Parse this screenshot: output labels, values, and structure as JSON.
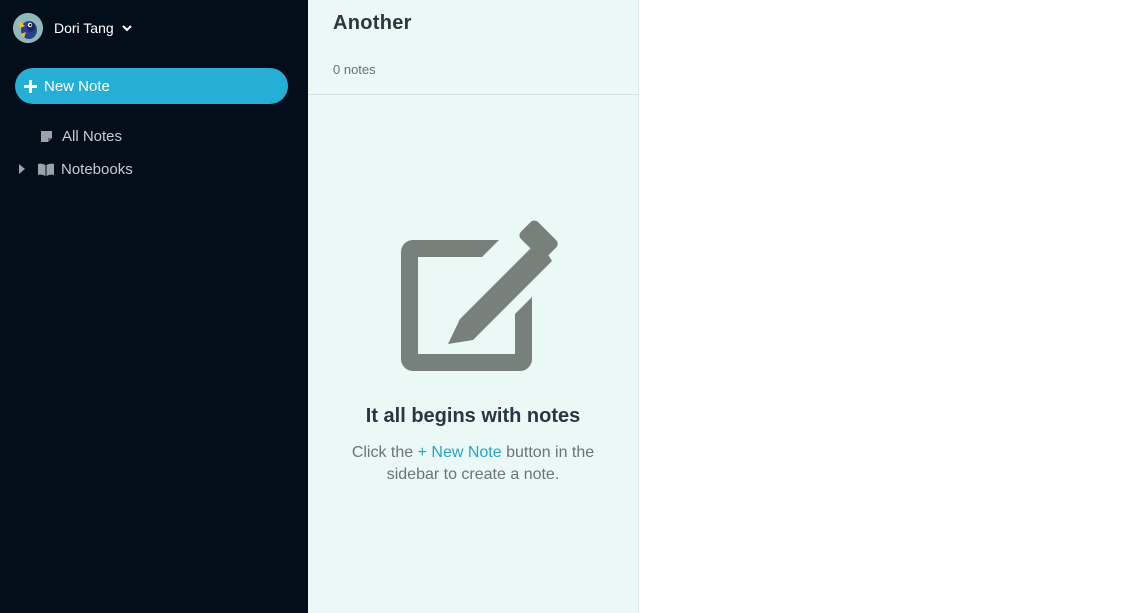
{
  "sidebar": {
    "user": {
      "name": "Dori Tang",
      "avatar_icon": "fish-avatar",
      "menu_icon": "chevron-down-icon"
    },
    "new_note_button": {
      "icon": "plus-icon",
      "label": "New Note",
      "color": "#26afd6"
    },
    "nav": {
      "all_notes": {
        "icon": "note-icon",
        "label": "All Notes"
      },
      "notebooks": {
        "caret_icon": "caret-right-icon",
        "icon": "book-icon",
        "label": "Notebooks"
      }
    },
    "background": "#020e1a"
  },
  "note_list": {
    "title": "Another",
    "count_label": "0 notes",
    "background": "#eaf8f6",
    "empty_state": {
      "icon": "edit-icon",
      "heading": "It all begins with notes",
      "text_before": "Click the ",
      "link": "+ New Note",
      "text_after": " button in the sidebar to create a note."
    }
  },
  "editor": {
    "background": "#ffffff"
  }
}
